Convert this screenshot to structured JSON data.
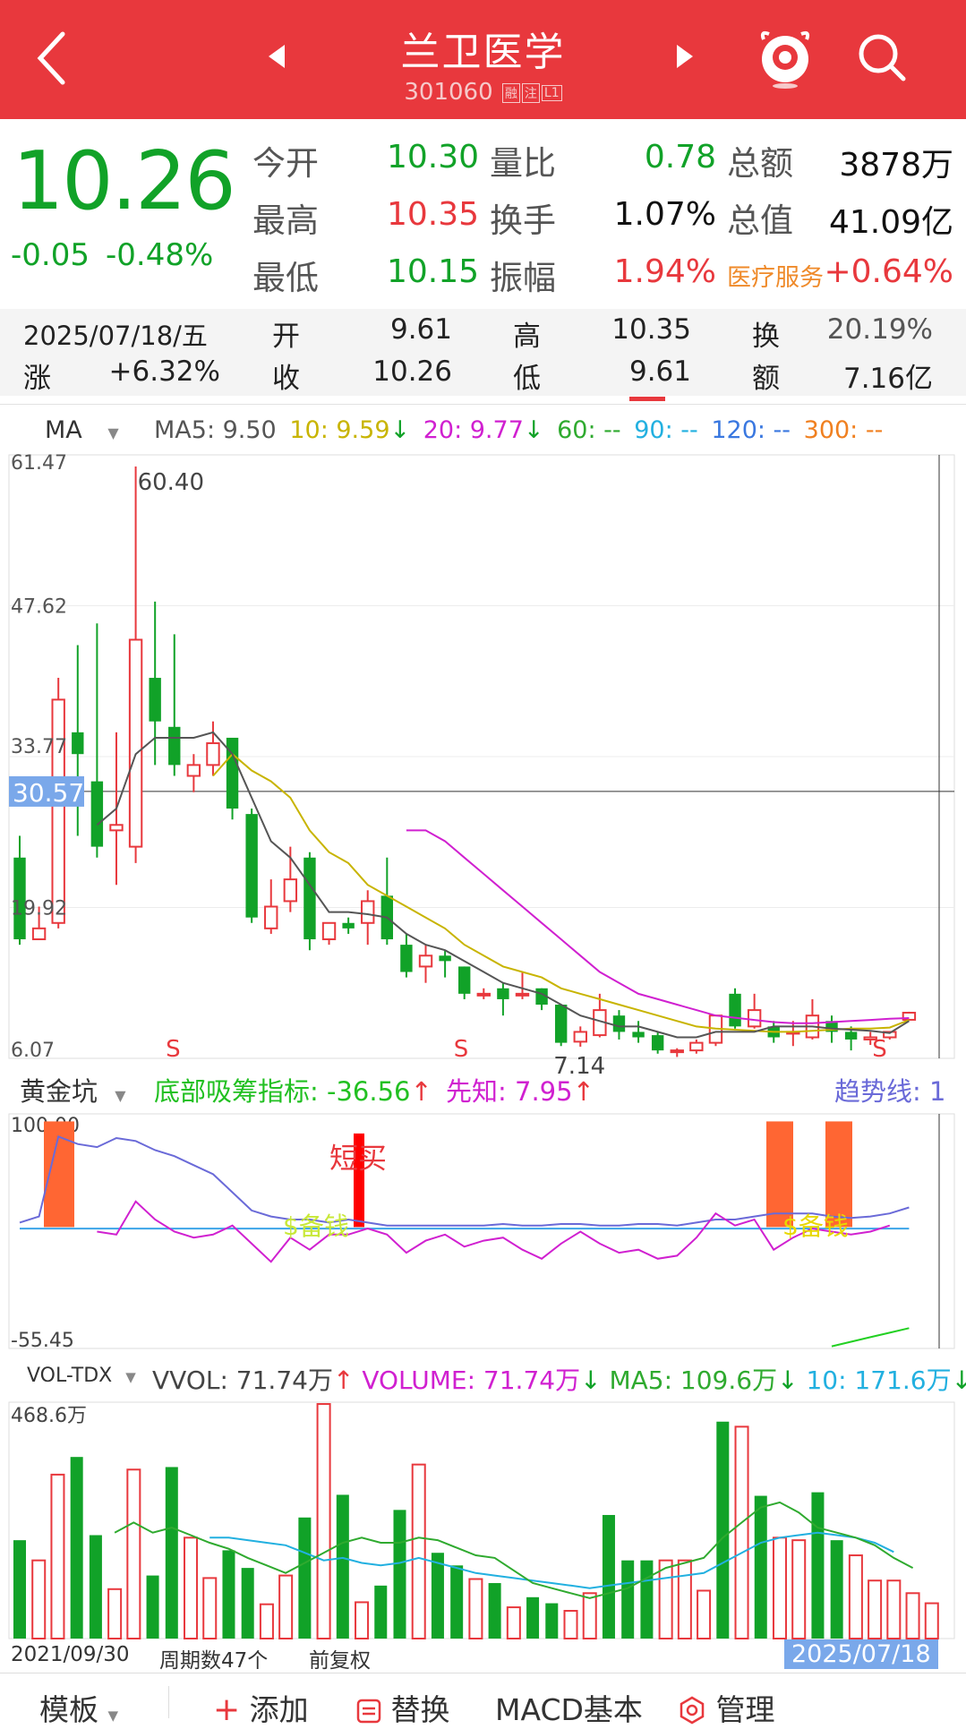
{
  "header": {
    "title": "兰卫医学",
    "code": "301060",
    "tags": [
      "融",
      "注",
      "L1"
    ]
  },
  "quote": {
    "price": "10.26",
    "change": "-0.05",
    "change_pct": "-0.48%",
    "rows": [
      {
        "l1": "今开",
        "v1": "10.30",
        "l2": "量比",
        "v2": "0.78",
        "l3": "总额",
        "v3": "3878万"
      },
      {
        "l1": "最高",
        "v1": "10.35",
        "l2": "换手",
        "v2": "1.07%",
        "l3": "总值",
        "v3": "41.09亿"
      },
      {
        "l1": "最低",
        "v1": "10.15",
        "l2": "振幅",
        "v2": "1.94%",
        "l3": "医疗服务",
        "v3": "+0.64%"
      }
    ]
  },
  "bar_info": {
    "date": "2025/07/18/五",
    "open_label": "开",
    "open": "9.61",
    "high_label": "高",
    "high": "10.35",
    "turnover_label": "换",
    "turnover": "20.19%",
    "rise_label": "涨",
    "rise": "+6.32%",
    "close_label": "收",
    "close": "10.26",
    "low_label": "低",
    "low": "9.61",
    "amount_label": "额",
    "amount": "7.16亿"
  },
  "ma_legend": {
    "name": "MA",
    "ma5": "MA5: 9.50",
    "ma10": "10: 9.59",
    "ma20": "20: 9.77",
    "ma60": "60: --",
    "ma90": "90: --",
    "ma120": "120: --",
    "ma300": "300: --"
  },
  "colors": {
    "up": "#e8383d",
    "down": "#11a228",
    "ma5": "#555555",
    "ma10": "#c8b400",
    "ma20": "#d020d0",
    "ma60": "#2faa2f",
    "ma90": "#22b0e0",
    "ma120": "#3a78e0",
    "ma300": "#f08020"
  },
  "price_axis": {
    "top": "61.47",
    "l2": "47.62",
    "l3": "33.77",
    "l4": "19.92",
    "bottom": "6.07",
    "crosshair": "30.57"
  },
  "price_annotations": {
    "high": "60.40",
    "low": "7.14",
    "signal": "S"
  },
  "indicator_legend": {
    "name": "黄金坑",
    "bottom": "底部吸筹指标: -36.56",
    "xianzhi": "先知: 7.95",
    "trend": "趋势线: 1"
  },
  "indicator_axis": {
    "top": "100.00",
    "bottom": "-55.45"
  },
  "indicator_labels": {
    "short_buy": "短买",
    "ready": "$备钱"
  },
  "volume_legend": {
    "name": "VOL-TDX",
    "vvol": "VVOL: 71.74万",
    "volume": "VOLUME: 71.74万",
    "ma5": "MA5: 109.6万",
    "ma10": "10: 171.6万"
  },
  "volume_axis": {
    "top": "468.6万"
  },
  "footer_info": {
    "start": "2021/09/30",
    "periods": "周期数47个",
    "adjust": "前复权",
    "end": "2025/07/18"
  },
  "toolbar": {
    "template": "模板",
    "add": "添加",
    "replace": "替换",
    "macd": "MACD基本",
    "manage": "管理"
  },
  "chart_data": {
    "type": "candlestick",
    "interval": "monthly",
    "ylim": [
      6.07,
      61.47
    ],
    "start": "2021/09/30",
    "end": "2025/07/18",
    "candles": [
      {
        "o": 24.5,
        "c": 17.0,
        "h": 26.5,
        "l": 16.5
      },
      {
        "o": 17.0,
        "c": 18.0,
        "h": 20.0,
        "l": 17.0
      },
      {
        "o": 18.5,
        "c": 39.0,
        "h": 41.0,
        "l": 18.0
      },
      {
        "o": 36.0,
        "c": 34.0,
        "h": 44.0,
        "l": 26.5
      },
      {
        "o": 31.5,
        "c": 25.5,
        "h": 46.0,
        "l": 24.5
      },
      {
        "o": 27.0,
        "c": 27.5,
        "h": 36.0,
        "l": 22.0
      },
      {
        "o": 25.5,
        "c": 44.5,
        "h": 60.4,
        "l": 24.0
      },
      {
        "o": 41.0,
        "c": 37.0,
        "h": 48.0,
        "l": 33.0
      },
      {
        "o": 36.5,
        "c": 33.0,
        "h": 45.0,
        "l": 32.0
      },
      {
        "o": 32.0,
        "c": 33.0,
        "h": 34.0,
        "l": 30.5
      },
      {
        "o": 33.0,
        "c": 35.0,
        "h": 37.0,
        "l": 32.0
      },
      {
        "o": 35.5,
        "c": 29.0,
        "h": 35.5,
        "l": 28.0
      },
      {
        "o": 28.5,
        "c": 19.0,
        "h": 29.0,
        "l": 18.5
      },
      {
        "o": 18.0,
        "c": 20.0,
        "h": 22.5,
        "l": 17.5
      },
      {
        "o": 20.5,
        "c": 22.5,
        "h": 25.5,
        "l": 19.5
      },
      {
        "o": 24.5,
        "c": 17.0,
        "h": 25.0,
        "l": 16.0
      },
      {
        "o": 17.0,
        "c": 18.5,
        "h": 18.5,
        "l": 16.5
      },
      {
        "o": 18.5,
        "c": 18.0,
        "h": 19.0,
        "l": 17.5
      },
      {
        "o": 18.5,
        "c": 20.5,
        "h": 21.5,
        "l": 16.5
      },
      {
        "o": 21.0,
        "c": 17.0,
        "h": 24.5,
        "l": 16.5
      },
      {
        "o": 16.5,
        "c": 14.0,
        "h": 17.5,
        "l": 13.5
      },
      {
        "o": 14.5,
        "c": 15.5,
        "h": 16.5,
        "l": 13.0
      },
      {
        "o": 15.5,
        "c": 15.0,
        "h": 16.0,
        "l": 13.5
      },
      {
        "o": 14.5,
        "c": 12.0,
        "h": 14.5,
        "l": 11.5
      },
      {
        "o": 12.0,
        "c": 12.0,
        "h": 12.5,
        "l": 11.5
      },
      {
        "o": 12.5,
        "c": 11.5,
        "h": 13.0,
        "l": 10.0
      },
      {
        "o": 12.0,
        "c": 12.0,
        "h": 14.0,
        "l": 11.5
      },
      {
        "o": 12.5,
        "c": 11.0,
        "h": 12.5,
        "l": 10.5
      },
      {
        "o": 11.0,
        "c": 7.5,
        "h": 11.0,
        "l": 7.2
      },
      {
        "o": 7.6,
        "c": 8.5,
        "h": 9.0,
        "l": 7.14
      },
      {
        "o": 8.2,
        "c": 10.5,
        "h": 12.0,
        "l": 8.0
      },
      {
        "o": 10.0,
        "c": 8.5,
        "h": 10.5,
        "l": 7.8
      },
      {
        "o": 8.5,
        "c": 8.0,
        "h": 9.5,
        "l": 7.5
      },
      {
        "o": 8.2,
        "c": 6.8,
        "h": 8.5,
        "l": 6.5
      },
      {
        "o": 6.7,
        "c": 6.8,
        "h": 7.0,
        "l": 6.2
      },
      {
        "o": 6.8,
        "c": 7.5,
        "h": 7.8,
        "l": 6.5
      },
      {
        "o": 7.5,
        "c": 10.0,
        "h": 10.0,
        "l": 7.2
      },
      {
        "o": 12.0,
        "c": 9.0,
        "h": 12.5,
        "l": 8.8
      },
      {
        "o": 9.0,
        "c": 10.5,
        "h": 12.0,
        "l": 8.8
      },
      {
        "o": 9.0,
        "c": 8.0,
        "h": 9.5,
        "l": 7.5
      },
      {
        "o": 8.5,
        "c": 8.5,
        "h": 9.5,
        "l": 7.2
      },
      {
        "o": 8.0,
        "c": 10.0,
        "h": 11.5,
        "l": 7.8
      },
      {
        "o": 9.5,
        "c": 8.5,
        "h": 10.0,
        "l": 7.5
      },
      {
        "o": 8.5,
        "c": 7.8,
        "h": 9.0,
        "l": 6.8
      },
      {
        "o": 7.8,
        "c": 8.0,
        "h": 8.5,
        "l": 7.3
      },
      {
        "o": 8.0,
        "c": 8.5,
        "h": 8.5,
        "l": 7.8
      },
      {
        "o": 9.61,
        "c": 10.26,
        "h": 10.35,
        "l": 9.61
      }
    ],
    "ma5": [
      null,
      null,
      null,
      null,
      27.5,
      29.0,
      34.0,
      35.5,
      35.5,
      35.5,
      36.0,
      34.0,
      30.0,
      26.0,
      24.5,
      22.0,
      19.5,
      19.5,
      19.3,
      19.0,
      17.5,
      16.5,
      16.0,
      15.0,
      14.0,
      13.0,
      12.5,
      12.0,
      11.0,
      10.0,
      9.5,
      9.0,
      9.0,
      8.5,
      8.0,
      8.0,
      8.5,
      8.5,
      8.5,
      9.0,
      9.0,
      9.0,
      8.8,
      8.7,
      8.6,
      8.4,
      9.5
    ],
    "ma10": [
      null,
      null,
      null,
      null,
      null,
      null,
      null,
      null,
      null,
      null,
      32.0,
      34.0,
      32.5,
      31.5,
      30.0,
      27.0,
      25.0,
      24.0,
      22.0,
      21.0,
      20.0,
      19.0,
      18.0,
      16.5,
      15.5,
      14.5,
      14.0,
      13.5,
      12.5,
      12.0,
      11.5,
      11.0,
      10.5,
      10.0,
      9.5,
      9.0,
      8.8,
      8.7,
      8.6,
      8.5,
      8.5,
      8.6,
      8.7,
      8.8,
      8.8,
      8.9,
      9.59
    ],
    "ma20": [
      null,
      null,
      null,
      null,
      null,
      null,
      null,
      null,
      null,
      null,
      null,
      null,
      null,
      null,
      null,
      null,
      null,
      null,
      null,
      null,
      27.0,
      27.0,
      26.0,
      24.5,
      23.0,
      21.5,
      20.0,
      18.5,
      17.0,
      15.5,
      14.0,
      13.0,
      12.0,
      11.5,
      11.0,
      10.5,
      10.0,
      9.8,
      9.6,
      9.4,
      9.3,
      9.3,
      9.4,
      9.5,
      9.6,
      9.7,
      9.77
    ],
    "volume_max": 468.6,
    "volume": [
      195,
      155,
      325,
      360,
      205,
      98,
      335,
      125,
      340,
      200,
      120,
      175,
      140,
      68,
      125,
      240,
      465,
      285,
      72,
      105,
      255,
      345,
      170,
      145,
      118,
      110,
      62,
      82,
      70,
      55,
      90,
      245,
      155,
      155,
      155,
      155,
      95,
      430,
      420,
      283,
      200,
      195,
      290,
      195,
      165,
      115,
      115,
      90,
      70
    ],
    "vol_ma5": [
      null,
      null,
      null,
      null,
      null,
      210,
      230,
      210,
      220,
      205,
      190,
      178,
      160,
      145,
      130,
      150,
      170,
      190,
      200,
      190,
      190,
      200,
      195,
      180,
      165,
      160,
      135,
      110,
      100,
      90,
      80,
      90,
      100,
      120,
      140,
      150,
      160,
      200,
      230,
      260,
      270,
      250,
      220,
      210,
      200,
      185,
      160,
      140
    ],
    "vol_ma10": [
      null,
      null,
      null,
      null,
      null,
      null,
      null,
      null,
      null,
      null,
      200,
      200,
      195,
      190,
      185,
      170,
      155,
      160,
      150,
      145,
      150,
      160,
      150,
      140,
      130,
      125,
      120,
      115,
      110,
      105,
      100,
      105,
      110,
      115,
      120,
      125,
      130,
      150,
      170,
      190,
      200,
      205,
      210,
      205,
      200,
      190,
      171.6
    ]
  }
}
